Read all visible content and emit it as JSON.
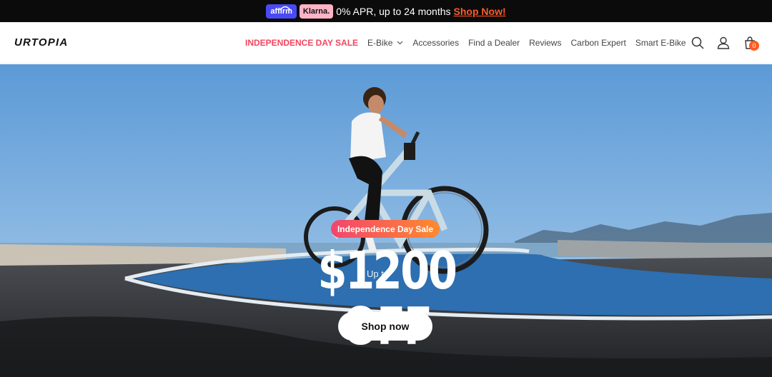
{
  "promo": {
    "affirm_label": "affirm",
    "klarna_label": "Klarna.",
    "text": "0% APR, up to 24 months",
    "link": "Shop Now!",
    "link_color": "#ff5a2a"
  },
  "header": {
    "logo": "URTOPIA",
    "nav": [
      {
        "label": "INDEPENDENCE DAY SALE",
        "highlight": true
      },
      {
        "label": "E-Bike",
        "dropdown": true
      },
      {
        "label": "Accessories"
      },
      {
        "label": "Find a Dealer"
      },
      {
        "label": "Reviews"
      },
      {
        "label": "Carbon Expert"
      },
      {
        "label": "Smart E-Bike"
      }
    ],
    "icons": [
      "search-icon",
      "user-icon",
      "cart-icon"
    ],
    "cart_count": "0"
  },
  "hero": {
    "badge": "Independence Day Sale",
    "prefix": "Up to",
    "headline": "$1200 OFF",
    "cta": "Shop now",
    "accent_gradient": [
      "#f2456f",
      "#ff8a2c"
    ]
  }
}
